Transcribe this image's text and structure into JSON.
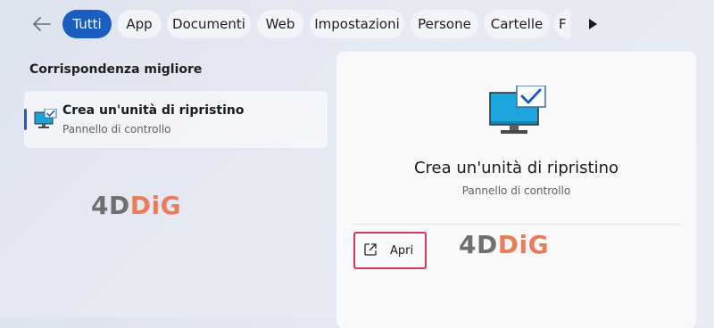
{
  "search_filters": {
    "back_icon": "arrow-left-icon",
    "tabs": [
      {
        "label": "Tutti",
        "active": true
      },
      {
        "label": "App",
        "active": false
      },
      {
        "label": "Documenti",
        "active": false
      },
      {
        "label": "Web",
        "active": false
      },
      {
        "label": "Impostazioni",
        "active": false
      },
      {
        "label": "Persone",
        "active": false
      },
      {
        "label": "Cartelle",
        "active": false
      },
      {
        "label": "F",
        "active": false
      }
    ],
    "more_icon": "play-triangle-icon",
    "accent_color": "#1a5fbf"
  },
  "best_match": {
    "heading": "Corrispondenza migliore",
    "item": {
      "icon": "monitor-checkmark-icon",
      "title": "Crea un'unità di ripristino",
      "subtitle": "Pannello di controllo"
    }
  },
  "preview": {
    "icon": "monitor-checkmark-icon",
    "title": "Crea un'unità di ripristino",
    "subtitle": "Pannello di controllo",
    "actions": [
      {
        "icon": "open-external-icon",
        "label": "Apri",
        "highlight_color": "#d6385a"
      }
    ]
  },
  "watermark": {
    "part1": "4D",
    "part2": "DiG",
    "color1": "#6f6f6f",
    "color2": "#e97d5b"
  }
}
